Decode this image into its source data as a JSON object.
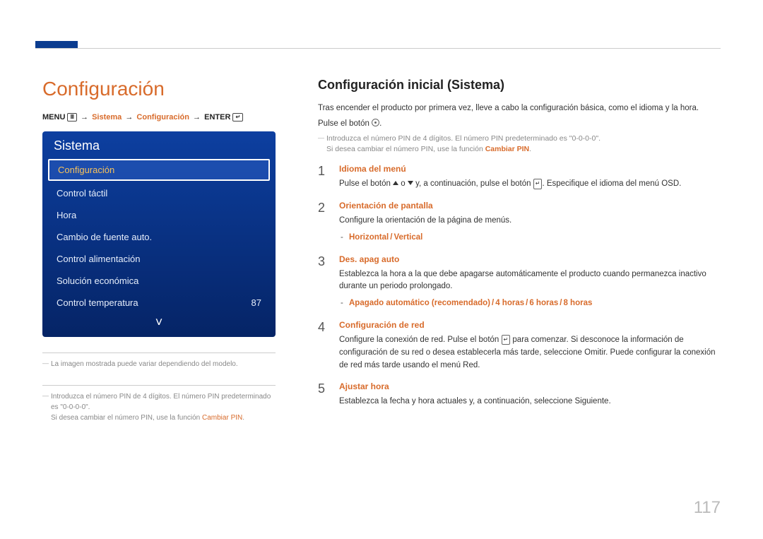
{
  "page_number": "117",
  "left": {
    "title": "Configuración",
    "breadcrumb": {
      "menu": "MENU",
      "path1": "Sistema",
      "path2": "Configuración",
      "enter": "ENTER"
    },
    "panel": {
      "title": "Sistema",
      "items": [
        {
          "label": "Configuración",
          "value": "",
          "selected": true
        },
        {
          "label": "Control táctil",
          "value": "",
          "selected": false
        },
        {
          "label": "Hora",
          "value": "",
          "selected": false
        },
        {
          "label": "Cambio de fuente auto.",
          "value": "",
          "selected": false
        },
        {
          "label": "Control alimentación",
          "value": "",
          "selected": false
        },
        {
          "label": "Solución económica",
          "value": "",
          "selected": false
        },
        {
          "label": "Control temperatura",
          "value": "87",
          "selected": false
        }
      ]
    },
    "footnote1": "La imagen mostrada puede variar dependiendo del modelo.",
    "footnote2_a": "Introduzca el número PIN de 4 dígitos. El número PIN predeterminado es \"0-0-0-0\".",
    "footnote2_b": "Si desea cambiar el número PIN, use la función ",
    "footnote2_hl": "Cambiar PIN"
  },
  "right": {
    "title": "Configuración inicial (Sistema)",
    "intro1": "Tras encender el producto por primera vez, lleve a cabo la configuración básica, como el idioma y la hora.",
    "intro2a": "Pulse el botón ",
    "intro2b": ".",
    "note1": "Introduzca el número PIN de 4 dígitos. El número PIN predeterminado es \"0-0-0-0\".",
    "note2a": "Si desea cambiar el número PIN, use la función ",
    "note2hl": "Cambiar PIN",
    "note2b": ".",
    "steps": [
      {
        "head": "Idioma del menú",
        "body_parts": [
          "Pulse el botón ",
          " o ",
          " y, a continuación, pulse el botón ",
          ". Especifique el idioma del menú OSD."
        ]
      },
      {
        "head": "Orientación de pantalla",
        "body": "Configure la orientación de la página de menús.",
        "options": [
          "Horizontal",
          "Vertical"
        ]
      },
      {
        "head": "Des. apag auto",
        "body": "Establezca la hora a la que debe apagarse automáticamente el producto cuando permanezca inactivo durante un periodo prolongado.",
        "options": [
          "Apagado automático (recomendado)",
          "4 horas",
          "6 horas",
          "8 horas"
        ]
      },
      {
        "head": "Configuración de red",
        "body_parts": [
          "Configure la conexión de red. Pulse el botón ",
          " para comenzar. Si desconoce la información de configuración de su red o desea establecerla más tarde, seleccione "
        ],
        "body_hl1": "Omitir",
        "body_mid": ". Puede configurar la conexión de red más tarde usando el menú ",
        "body_hl2": "Red",
        "body_end": "."
      },
      {
        "head": "Ajustar hora",
        "body_a": "Establezca la fecha y hora actuales y, a continuación, seleccione ",
        "body_hl": "Siguiente",
        "body_b": "."
      }
    ]
  }
}
